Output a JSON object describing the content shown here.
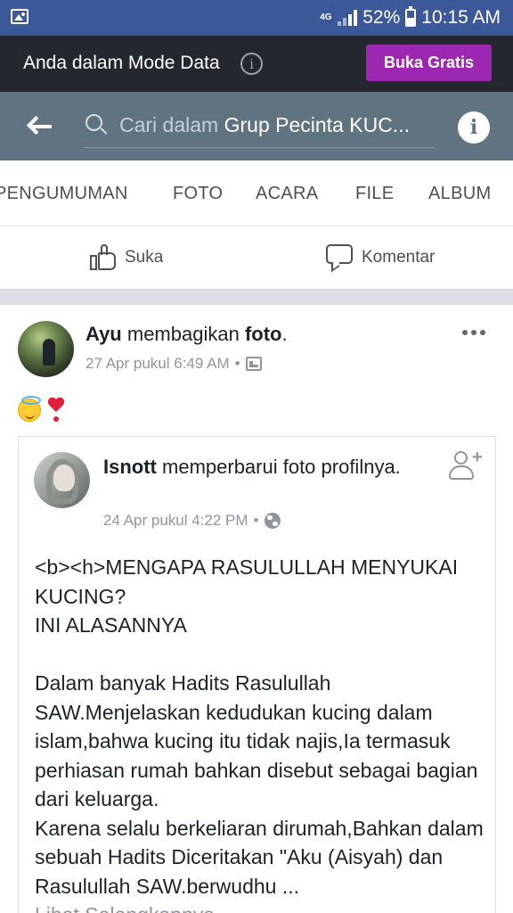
{
  "status_bar": {
    "network": "4G",
    "battery_percent": "52%",
    "battery_level": 0.52,
    "time": "10:15 AM",
    "icons": [
      "gallery-icon",
      "signal-icon",
      "battery-icon"
    ]
  },
  "data_banner": {
    "text": "Anda dalam Mode Data",
    "info_icon": "i",
    "button_label": "Buka Gratis",
    "button_color": "#9c27b0"
  },
  "search": {
    "placeholder": "Cari dalam",
    "group_name": "Grup Pecinta KUC...",
    "info_label": "i"
  },
  "tabs": [
    "PENGUMUMAN",
    "FOTO",
    "ACARA",
    "FILE",
    "ALBUM"
  ],
  "actions": {
    "like_label": "Suka",
    "comment_label": "Komentar"
  },
  "post": {
    "author": "Ayu",
    "verb": " membagikan ",
    "object": "foto",
    "suffix": ".",
    "timestamp": "27 Apr pukul 6:49 AM",
    "separator": "•",
    "shared": {
      "author": "Isnott",
      "action_text": " memperbarui foto profilnya.",
      "timestamp": "24 Apr pukul 4:22 PM",
      "separator": "•",
      "body": "<b><h>MENGAPA RASULULLAH MENYUKAI KUCING?\nINI ALASANNYA\n\nDalam banyak Hadits Rasulullah SAW.Menjelaskan kedudukan kucing dalam islam,bahwa kucing itu tidak najis,Ia termasuk perhiasan rumah bahkan disebut sebagai bagian dari keluarga.\nKarena selalu berkeliaran dirumah,Bahkan dalam sebuah Hadits Diceritakan \"Aku (Aisyah) dan Rasulullah SAW.berwudhu ...",
      "see_more": "Lihat Selengkapnya"
    }
  },
  "colors": {
    "status_bar": "#3b5998",
    "data_banner": "#23282f",
    "search_header": "#5f7381"
  }
}
